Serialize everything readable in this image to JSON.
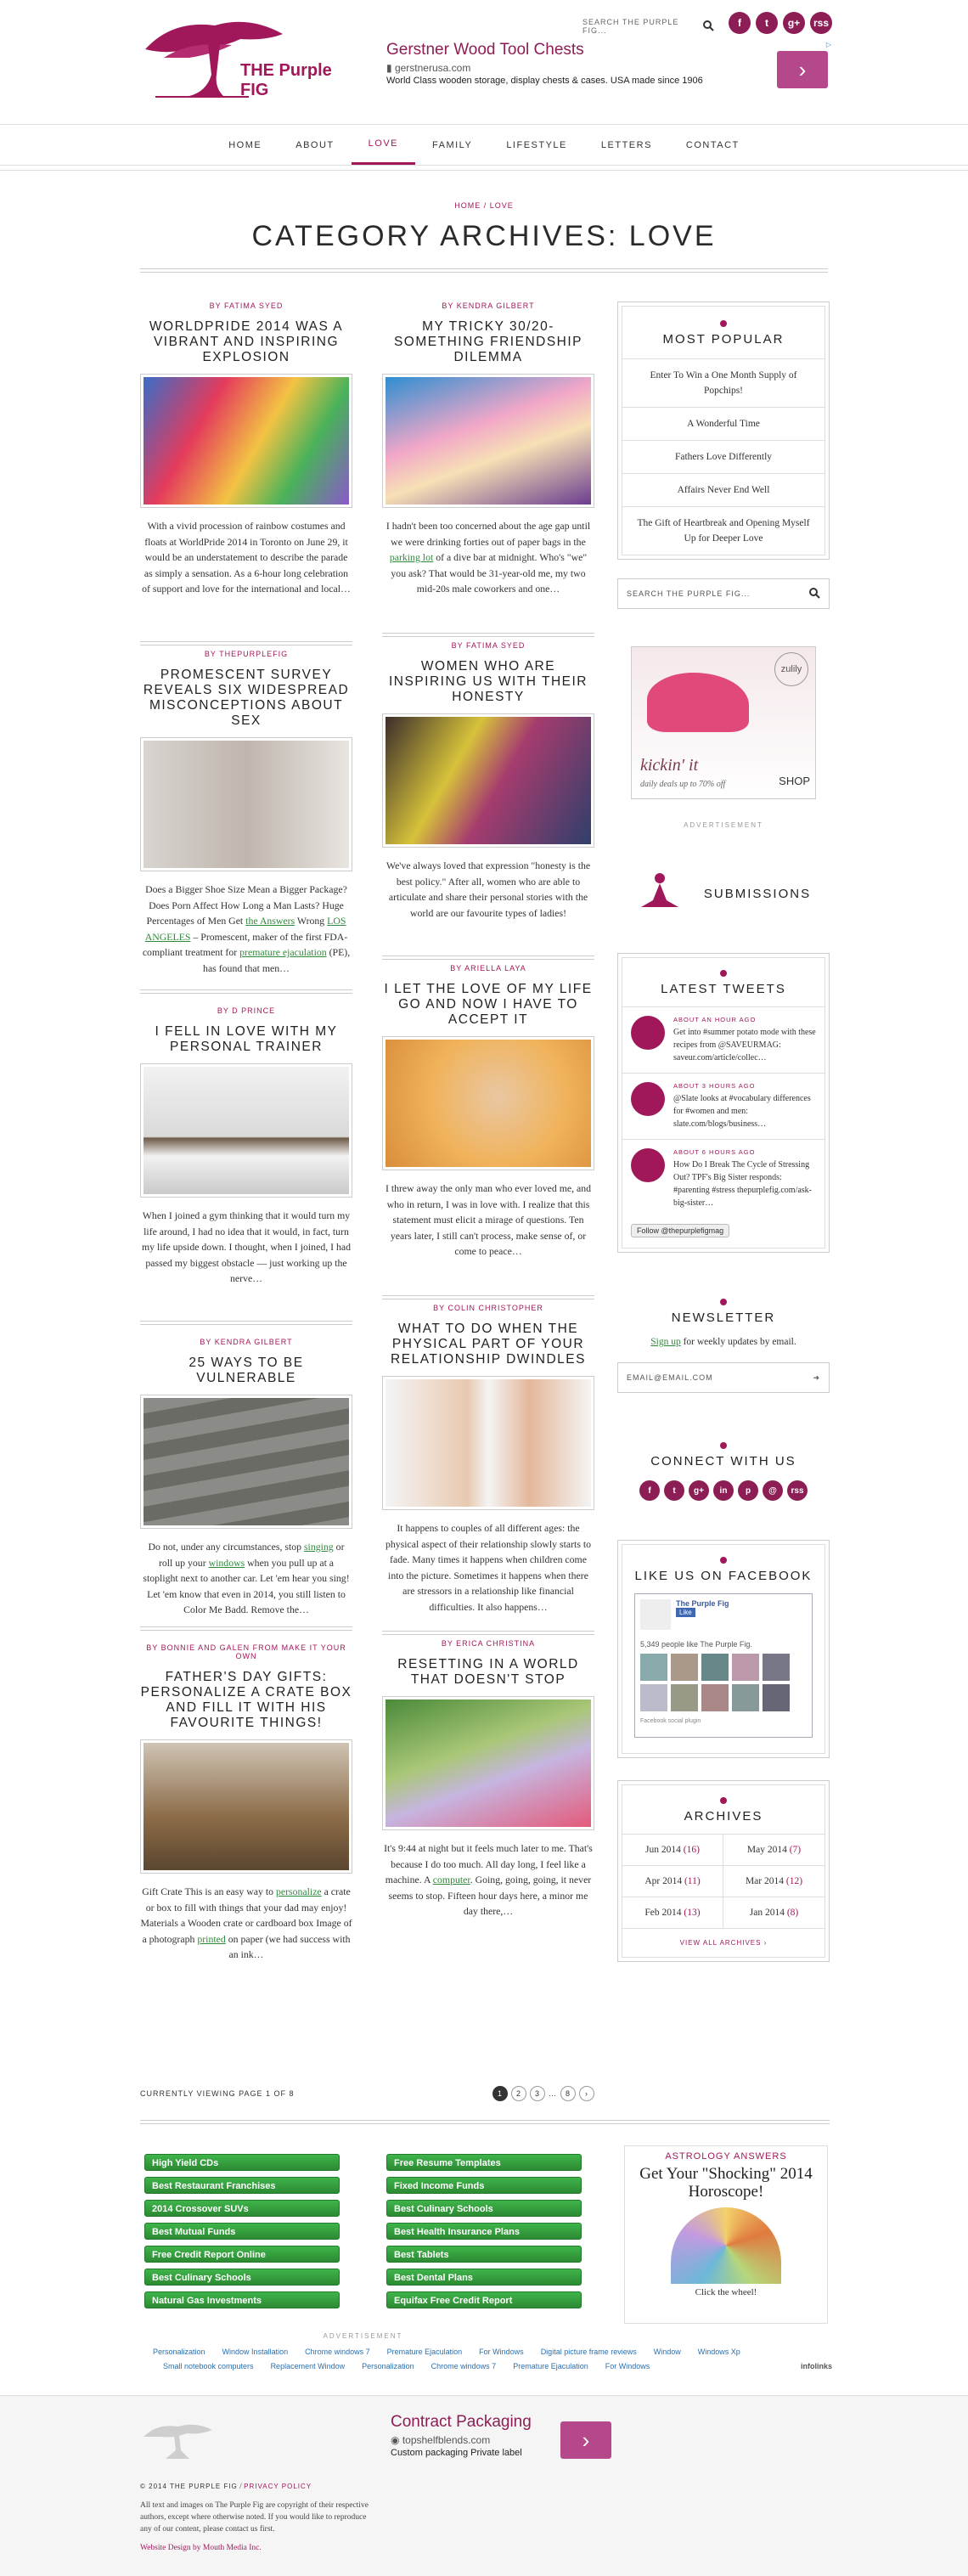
{
  "header": {
    "logo_text": "THE Purple FIG",
    "search_placeholder": "SEARCH THE PURPLE FIG...",
    "social": [
      "f",
      "t",
      "g+",
      "rss"
    ],
    "ad": {
      "title": "Gerstner Wood Tool Chests",
      "url": "gerstnerusa.com",
      "desc": "World Class wooden storage, display chests & cases. USA made since 1906",
      "btn": "›"
    }
  },
  "nav": [
    "HOME",
    "ABOUT",
    "LOVE",
    "FAMILY",
    "LIFESTYLE",
    "LETTERS",
    "CONTACT"
  ],
  "breadcrumb": {
    "home": "HOME",
    "sep": "/",
    "current": "LOVE"
  },
  "page_title": "CATEGORY ARCHIVES: LOVE",
  "posts": [
    {
      "by": "BY FATIMA SYED",
      "title": "WORLDPRIDE 2014 WAS A VIBRANT AND INSPIRING EXPLOSION",
      "excerpt": "With a vivid procession of rainbow costumes and floats at WorldPride 2014 in Toronto on June 29, it would be an understatement to describe the parade as simply a sensation. As a 6-hour long celebration of support and love for the international and local…"
    },
    {
      "by": "BY KENDRA GILBERT",
      "title": "MY TRICKY 30/20-SOMETHING FRIENDSHIP DILEMMA",
      "excerpt_a": "I hadn't been too concerned about the age gap until we were drinking forties out of paper bags in the ",
      "excerpt_link": "parking lot",
      "excerpt_b": " of a dive bar at midnight. Who's \"we\" you ask? That would be 31-year-old me, my two mid-20s male coworkers and one…"
    },
    {
      "by": "BY THEPURPLEFIG",
      "title": "PROMESCENT SURVEY REVEALS SIX WIDESPREAD MISCONCEPTIONS ABOUT SEX",
      "excerpt_a": "Does a Bigger Shoe Size Mean a Bigger Package? Does Porn Affect How Long a Man Lasts? Huge Percentages of Men Get ",
      "excerpt_link": "the Answers",
      "excerpt_b": " Wrong ",
      "excerpt_link2": "LOS ANGELES",
      "excerpt_c": " – Promescent, maker of the first FDA-compliant treatment for ",
      "excerpt_link3": "premature ejaculation",
      "excerpt_d": " (PE), has found that men…"
    },
    {
      "by": "BY FATIMA SYED",
      "title": "WOMEN WHO ARE INSPIRING US WITH THEIR HONESTY",
      "excerpt": "We've always loved that expression \"honesty is the best policy.\" After all, women who are able to articulate and share their personal stories with the world are our favourite types of ladies!"
    },
    {
      "by": "BY D PRINCE",
      "title": "I FELL IN LOVE WITH MY PERSONAL TRAINER",
      "excerpt": "When I joined a gym thinking that it would turn my life around, I had no idea that it would, in fact, turn my life upside down. I thought, when I joined, I had passed my biggest obstacle — just working up the nerve…"
    },
    {
      "by": "BY ARIELLA LAYA",
      "title": "I LET THE LOVE OF MY LIFE GO AND NOW I HAVE TO ACCEPT IT",
      "excerpt": "I threw away the only man who ever loved me, and who in return, I was in love with. I realize that this statement must elicit a mirage of questions. Ten years later, I still can't process, make sense of, or come to peace…"
    },
    {
      "by": "BY KENDRA GILBERT",
      "title": "25 WAYS TO BE VULNERABLE",
      "excerpt_a": "Do not, under any circumstances, stop ",
      "excerpt_link": "singing",
      "excerpt_b": " or roll up your ",
      "excerpt_link2": "windows",
      "excerpt_c": " when you pull up at a stoplight next to another car. Let 'em hear you sing! Let 'em know that even in 2014, you still listen to Color Me Badd. Remove the…"
    },
    {
      "by": "BY COLIN CHRISTOPHER",
      "title": "WHAT TO DO WHEN THE PHYSICAL PART OF YOUR RELATIONSHIP DWINDLES",
      "excerpt": "It happens to couples of all different ages: the physical aspect of their relationship slowly starts to fade.  Many times it happens when children come into the picture.  Sometimes it happens when there are stressors in a relationship like financial difficulties.  It also happens…"
    },
    {
      "by": "BY BONNIE AND GALEN FROM MAKE IT YOUR OWN",
      "title": "FATHER'S DAY GIFTS: PERSONALIZE A CRATE BOX AND FILL IT WITH HIS FAVOURITE THINGS!",
      "excerpt_a": "Gift Crate  This is an easy way to ",
      "excerpt_link": "personalize",
      "excerpt_b": " a crate or box to fill with things that your dad may enjoy! Materials  a Wooden crate or cardboard box Image of a photograph ",
      "excerpt_link2": "printed",
      "excerpt_c": " on paper (we had success with an ink…"
    },
    {
      "by": "BY ERICA CHRISTINA",
      "title": "RESETTING IN A WORLD THAT DOESN'T STOP",
      "excerpt_a": "It's 9:44 at night but it feels much later to me. That's because I do too much. All day long, I feel like a machine. A ",
      "excerpt_link": "computer",
      "excerpt_b": ". Going, going, going, it never seems to stop. Fifteen hour days here, a minor me day there,…"
    }
  ],
  "pagination": {
    "label": "CURRENTLY VIEWING PAGE 1 OF 8",
    "pages": [
      "1",
      "2",
      "3",
      "…",
      "8",
      "›"
    ]
  },
  "sidebar": {
    "popular_title": "MOST POPULAR",
    "popular": [
      "Enter To Win a One Month Supply of Popchips!",
      "A Wonderful Time",
      "Fathers Love Differently",
      "Affairs Never End Well",
      "The Gift of Heartbreak and Opening Myself Up for Deeper Love"
    ],
    "search_placeholder": "SEARCH THE PURPLE FIG...",
    "ad_brand": "zulily",
    "ad_text": "kickin' it",
    "ad_sub": "daily deals up to 70% off",
    "ad_btn": "SHOP",
    "advertisement": "ADVERTISEMENT",
    "submissions": "SUBMISSIONS",
    "tweets_title": "LATEST TWEETS",
    "tweets": [
      {
        "ago": "ABOUT AN HOUR AGO",
        "text": "Get into #summer potato mode with these recipes from @SAVEURMAG: saveur.com/article/collec…"
      },
      {
        "ago": "ABOUT 3 HOURS AGO",
        "text": "@Slate looks at #vocabulary differences for #women and men: slate.com/blogs/business…"
      },
      {
        "ago": "ABOUT 6 HOURS AGO",
        "text": "How Do I Break The Cycle of Stressing Out? TPF's Big Sister responds: #parenting #stress thepurplefig.com/ask-big-sister…"
      }
    ],
    "follow_btn": "Follow @thepurplefigmag",
    "newsletter_title": "NEWSLETTER",
    "newsletter_link": "Sign up",
    "newsletter_text": " for weekly updates by email.",
    "newsletter_placeholder": "EMAIL@EMAIL.COM",
    "connect_title": "CONNECT WITH US",
    "connect_icons": [
      "f",
      "t",
      "g+",
      "in",
      "p",
      "@",
      "rss"
    ],
    "facebook_title": "LIKE US ON FACEBOOK",
    "fb_page": "The Purple Fig",
    "fb_like": "Like",
    "fb_count": "5,349 people like The Purple Fig.",
    "fb_plugin": "Facebook social plugin",
    "archives_title": "ARCHIVES",
    "archives": [
      {
        "m": "Jun 2014",
        "n": "(16)"
      },
      {
        "m": "May 2014",
        "n": "(7)"
      },
      {
        "m": "Apr 2014",
        "n": "(11)"
      },
      {
        "m": "Mar 2014",
        "n": "(12)"
      },
      {
        "m": "Feb 2014",
        "n": "(13)"
      },
      {
        "m": "Jan 2014",
        "n": "(8)"
      }
    ],
    "archives_all": "VIEW ALL ARCHIVES ›"
  },
  "bottom_ads": {
    "col1": [
      "High Yield CDs",
      "Best Restaurant Franchises",
      "2014 Crossover SUVs",
      "Best Mutual Funds",
      "Free Credit Report Online",
      "Best Culinary Schools",
      "Natural Gas Investments"
    ],
    "col2": [
      "Free Resume Templates",
      "Fixed Income Funds",
      "Best Culinary Schools",
      "Best Health Insurance Plans",
      "Best Tablets",
      "Best Dental Plans",
      "Equifax Free Credit Report"
    ],
    "links1": [
      "Personalization",
      "Window Installation",
      "Chrome windows 7",
      "Premature Ejaculation",
      "For Windows",
      "Digital picture frame reviews",
      "Window",
      "Windows Xp"
    ],
    "links2": [
      "Small notebook computers",
      "Replacement Window",
      "Personalization",
      "Chrome windows 7",
      "Premature Ejaculation",
      "For Windows"
    ],
    "infolinks": "infolinks",
    "advertisement": "ADVERTISEMENT",
    "astro_brand": "ASTROLOGY ANSWERS",
    "astro_text": "Get Your \"Shocking\" 2014 Horoscope!",
    "astro_cta": "Click the wheel!"
  },
  "footer": {
    "ad_title": "Contract Packaging",
    "ad_url": "topshelfblends.com",
    "ad_desc": "Custom packaging Private label",
    "copyright": "© 2014 THE PURPLE FIG",
    "privacy": "PRIVACY POLICY",
    "legal": "All text and images on The Purple Fig are copyright of their respective authors, except where otherwise noted. If you would like to reproduce any of our content, please contact us first.",
    "design": "Website Design by Mouth Media Inc."
  },
  "colors": {
    "brand": "#a0185a",
    "link": "#2e8a3a"
  }
}
